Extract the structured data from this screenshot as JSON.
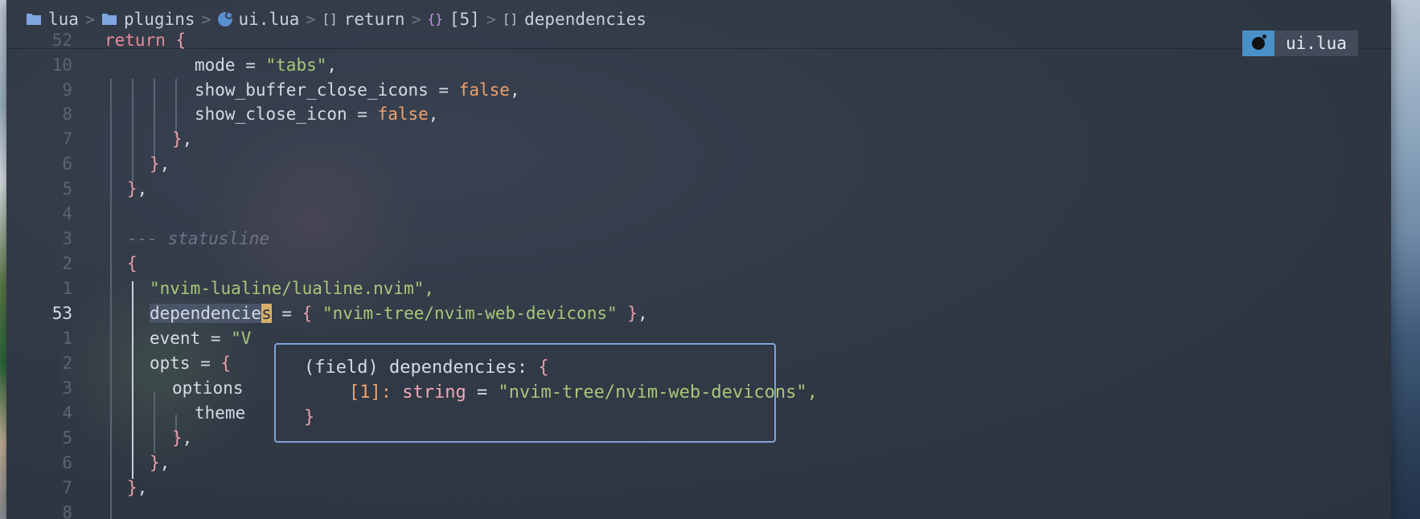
{
  "breadcrumb": {
    "items": [
      {
        "label": "lua",
        "icon": "folder-icon"
      },
      {
        "label": "plugins",
        "icon": "folder-icon"
      },
      {
        "label": "ui.lua",
        "icon": "lua-file-icon"
      },
      {
        "label": "return",
        "icon": "array-icon",
        "glyph": "[]"
      },
      {
        "label": "[5]",
        "icon": "object-icon",
        "glyph": "{}"
      },
      {
        "label": "dependencies",
        "icon": "array-icon",
        "glyph": "[]"
      }
    ],
    "separator": ">"
  },
  "file_tab": {
    "name": "ui.lua",
    "icon": "lua-file-icon"
  },
  "editor": {
    "lines": [
      {
        "num": "52",
        "code": "return {"
      },
      {
        "num": "10",
        "code": "mode = \"tabs\","
      },
      {
        "num": "9",
        "code": "show_buffer_close_icons = false,"
      },
      {
        "num": "8",
        "code": "show_close_icon = false,"
      },
      {
        "num": "7",
        "code": "},"
      },
      {
        "num": "6",
        "code": "},"
      },
      {
        "num": "5",
        "code": "},"
      },
      {
        "num": "4",
        "code": ""
      },
      {
        "num": "3",
        "code": "--- statusline"
      },
      {
        "num": "2",
        "code": "{"
      },
      {
        "num": "1",
        "code": "\"nvim-lualine/lualine.nvim\","
      },
      {
        "num": "53",
        "code": "dependencies = { \"nvim-tree/nvim-web-devicons\" },"
      },
      {
        "num": "1",
        "code": "event = \"V"
      },
      {
        "num": "2",
        "code": "opts = {"
      },
      {
        "num": "3",
        "code": "options"
      },
      {
        "num": "4",
        "code": "theme"
      },
      {
        "num": "5",
        "code": "},"
      },
      {
        "num": "6",
        "code": "},"
      },
      {
        "num": "7",
        "code": "},"
      },
      {
        "num": "8",
        "code": ""
      }
    ],
    "current_line": "53"
  },
  "hover": {
    "line1_field": "(field)",
    "line1_name": "dependencies:",
    "line1_brace": "{",
    "line2_index": "[1]:",
    "line2_type": "string",
    "line2_eq": "=",
    "line2_value": "\"nvim-tree/nvim-web-devicons\",",
    "line3": "}"
  },
  "colors": {
    "keyword": "#e88b9a",
    "string": "#a8c77a",
    "boolean": "#f0a06a",
    "comment": "#6c7585",
    "popup_border": "#7fa3d8",
    "tab_icon_bg": "#4a90c8"
  }
}
